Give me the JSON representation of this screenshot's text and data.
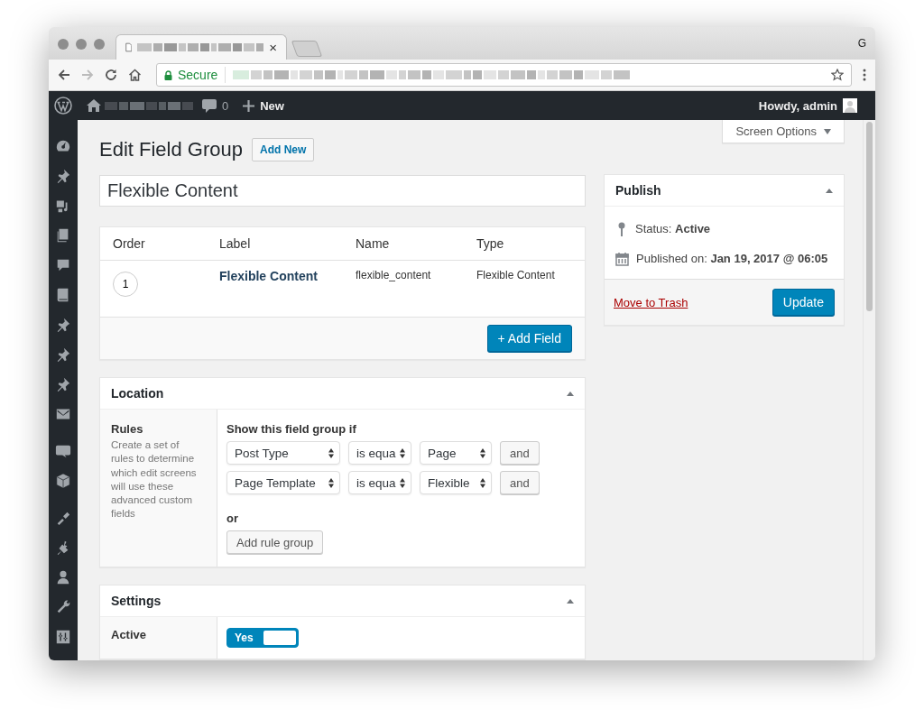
{
  "browser": {
    "tab": {
      "close": "×"
    },
    "address": {
      "secure_label": "Secure"
    },
    "profile_initial": "G"
  },
  "admin_bar": {
    "comments_count": "0",
    "new_label": "New",
    "greeting": "Howdy, admin"
  },
  "screen_options": {
    "label": "Screen Options",
    "expanded": false
  },
  "page": {
    "title": "Edit Field Group",
    "add_new": "Add New"
  },
  "title_field": {
    "value": "Flexible Content"
  },
  "fields_table": {
    "columns": [
      "Order",
      "Label",
      "Name",
      "Type"
    ],
    "rows": [
      {
        "order": "1",
        "label": "Flexible Content",
        "name": "flexible_content",
        "type": "Flexible Content"
      }
    ],
    "add_button": "+ Add Field"
  },
  "location": {
    "title": "Location",
    "rules_label": "Rules",
    "rules_description": "Create a set of rules to determine which edit screens will use these advanced custom fields",
    "condition_heading": "Show this field group if",
    "rules": [
      {
        "param": "Post Type",
        "operator": "is equa",
        "value": "Page",
        "and_button": "and"
      },
      {
        "param": "Page Template",
        "operator": "is equa",
        "value": "Flexible",
        "and_button": "and"
      }
    ],
    "or_label": "or",
    "add_group_button": "Add rule group"
  },
  "settings": {
    "title": "Settings",
    "rows": [
      {
        "label": "Active",
        "kind": "toggle",
        "on": true,
        "on_label": "Yes"
      }
    ]
  },
  "publish": {
    "title": "Publish",
    "status": "Status: **Active**",
    "published": "Published on: **Jan 19, 2017 @ 06:05**",
    "trash_link": "Move to Trash",
    "update_button": "Update"
  }
}
